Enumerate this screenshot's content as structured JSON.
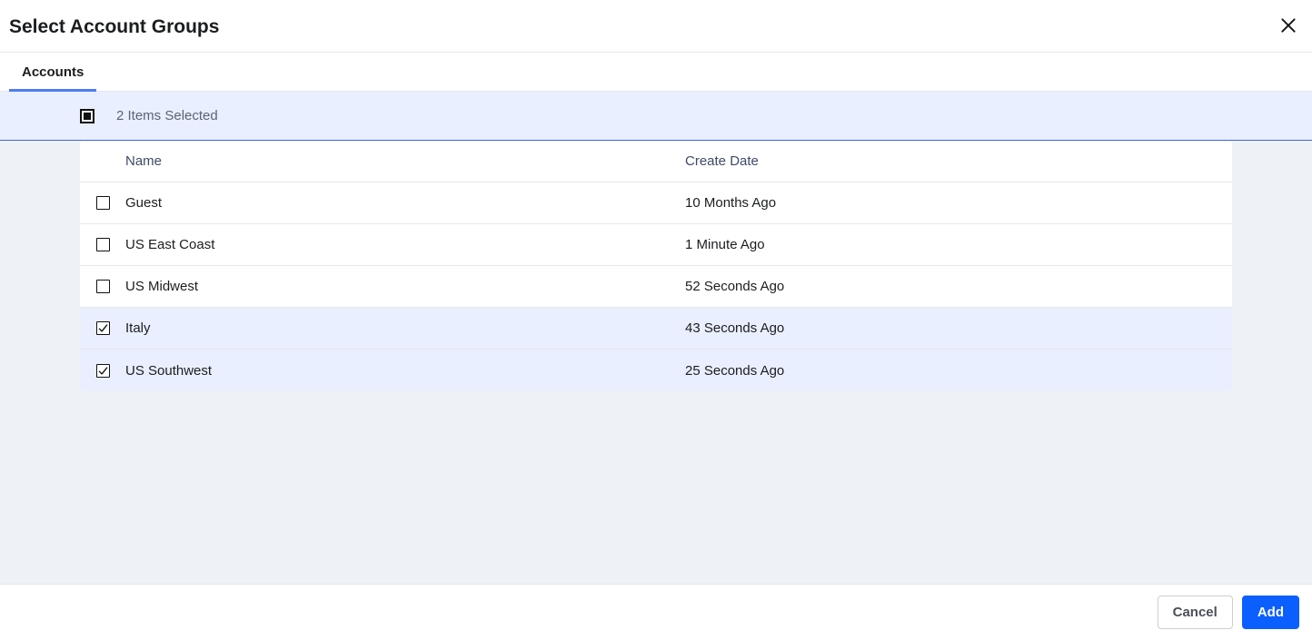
{
  "header": {
    "title": "Select Account Groups"
  },
  "tabs": {
    "active": "Accounts"
  },
  "selection": {
    "summary": "2 Items Selected"
  },
  "columns": {
    "name": "Name",
    "create_date": "Create Date"
  },
  "rows": [
    {
      "name": "Guest",
      "create_date": "10 Months Ago",
      "selected": false
    },
    {
      "name": "US East Coast",
      "create_date": "1 Minute Ago",
      "selected": false
    },
    {
      "name": "US Midwest",
      "create_date": "52 Seconds Ago",
      "selected": false
    },
    {
      "name": "Italy",
      "create_date": "43 Seconds Ago",
      "selected": true
    },
    {
      "name": "US Southwest",
      "create_date": "25 Seconds Ago",
      "selected": true
    }
  ],
  "footer": {
    "cancel": "Cancel",
    "add": "Add"
  }
}
